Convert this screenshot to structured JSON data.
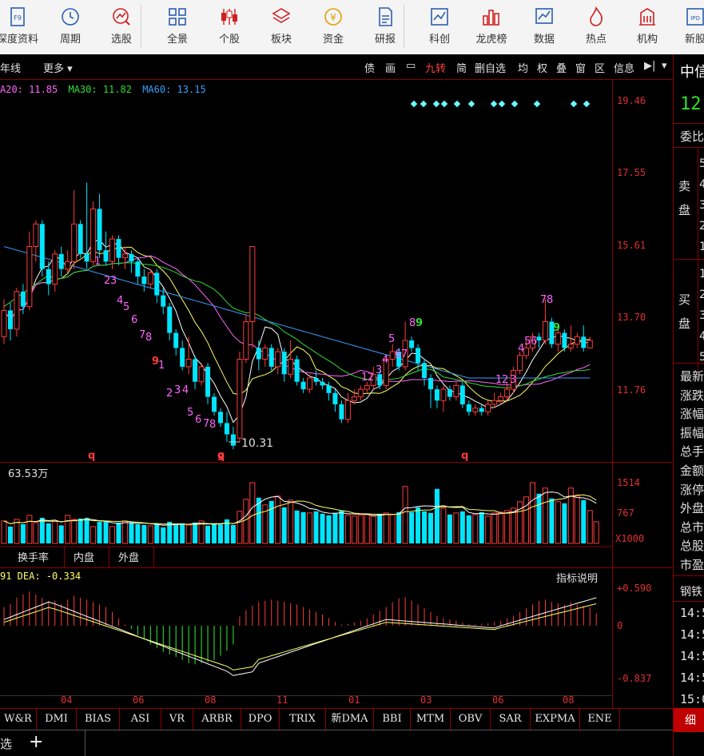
{
  "toolbar": {
    "items": [
      {
        "label": "深度资料",
        "icon": "f9-icon"
      },
      {
        "label": "周期",
        "icon": "clock-icon"
      },
      {
        "label": "选股",
        "icon": "stock-pick-icon"
      },
      {
        "label": "全景",
        "icon": "grid-icon"
      },
      {
        "label": "个股",
        "icon": "candlestick-icon"
      },
      {
        "label": "板块",
        "icon": "layers-icon"
      },
      {
        "label": "资金",
        "icon": "yen-icon"
      },
      {
        "label": "研报",
        "icon": "report-icon"
      },
      {
        "label": "科创",
        "icon": "sci-tech-icon"
      },
      {
        "label": "龙虎榜",
        "icon": "bar-ranking-icon"
      },
      {
        "label": "数据",
        "icon": "data-chart-icon"
      },
      {
        "label": "热点",
        "icon": "flame-icon"
      },
      {
        "label": "机构",
        "icon": "building-icon"
      },
      {
        "label": "新股",
        "icon": "ipo-icon"
      }
    ]
  },
  "subbar": {
    "left_label": "年线",
    "more_label": "更多",
    "right_items": [
      "债",
      "画",
      "九转",
      "简",
      "删自选",
      "均",
      "权",
      "叠",
      "窗",
      "区",
      "信息"
    ]
  },
  "ma_legend": {
    "ma20": "A20: 11.85",
    "ma30": "MA30: 11.82",
    "ma60": "MA60: 13.15"
  },
  "price_axis": [
    "19.46",
    "17.55",
    "15.61",
    "13.70",
    "11.76"
  ],
  "low_marker": "10.31",
  "volume": {
    "label": "63.53万",
    "axis": [
      "1514",
      "767",
      "X1000"
    ]
  },
  "tabs": [
    "换手率",
    "内盘",
    "外盘"
  ],
  "macd": {
    "legend": "91 DEA: -0.334",
    "help": "指标说明",
    "axis": [
      "+0.590",
      "0",
      "-0.837"
    ]
  },
  "month_labels": [
    "04",
    "06",
    "08",
    "11",
    "01",
    "03",
    "06",
    "08"
  ],
  "indicator_tabs": [
    "W&R",
    "DMI",
    "BIAS",
    "ASI",
    "VR",
    "ARBR",
    "DPO",
    "TRIX",
    "新DMA",
    "BBI",
    "MTM",
    "OBV",
    "SAR",
    "EXPMA",
    "ENE"
  ],
  "bottom": {
    "left": "选",
    "add": "+"
  },
  "right_panel": {
    "title": "中信",
    "price": "12.",
    "weibi": "委比",
    "sell": "卖\n盘",
    "buy": "买\n盘",
    "fields": [
      "最新",
      "涨跌",
      "涨幅",
      "振幅",
      "总手",
      "金额",
      "涨停",
      "外盘",
      "总市",
      "总股",
      "市盈"
    ],
    "sector": "钢铁",
    "times": [
      "14:5",
      "14:5",
      "14:5",
      "14:5",
      "15:0"
    ],
    "tab": "细"
  },
  "colors": {
    "up": "#ff3b3b",
    "down": "#00e5ff",
    "grid": "#8a0000",
    "ma5": "#ffffff",
    "ma10": "#ffff66",
    "ma20": "#ff66ff",
    "ma30": "#33dd33",
    "ma60": "#3aa0ff"
  }
}
